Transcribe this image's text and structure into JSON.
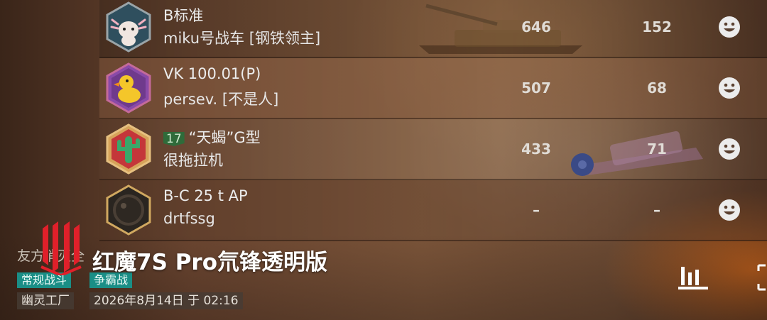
{
  "players": [
    {
      "vehicle": "B标准",
      "name": "miku号战车 [钢铁领主]",
      "level": "",
      "stat1": "646",
      "stat2": "152",
      "avatar_icon": "axolotl-icon"
    },
    {
      "vehicle": "VK 100.01(P)",
      "name": "persev. [不是人]",
      "level": "",
      "stat1": "507",
      "stat2": "68",
      "avatar_icon": "duck-icon"
    },
    {
      "vehicle": "“天蝎”G型",
      "name": "很拖拉机",
      "level": "17",
      "stat1": "433",
      "stat2": "71",
      "avatar_icon": "cactus-icon"
    },
    {
      "vehicle": "B-C 25 t AP",
      "name": "drtfssg",
      "level": "",
      "stat1": "–",
      "stat2": "–",
      "avatar_icon": "planet-icon"
    }
  ],
  "battle": {
    "title": "友方消灭全",
    "tags": [
      "常规战斗",
      "争霸战"
    ],
    "map": "幽灵工厂",
    "datetime": "2026年8月14日 于 02:16"
  },
  "watermark": {
    "text": "红魔7S Pro氘锋透明版"
  },
  "colors": {
    "tag_bg": "#1a8e86",
    "level_badge": "#2f6b3a",
    "accent_orange": "#ff7a1a"
  },
  "icons": {
    "stats": "bar-chart-icon",
    "expand": "expand-icon",
    "emote": "smiley-icon"
  }
}
